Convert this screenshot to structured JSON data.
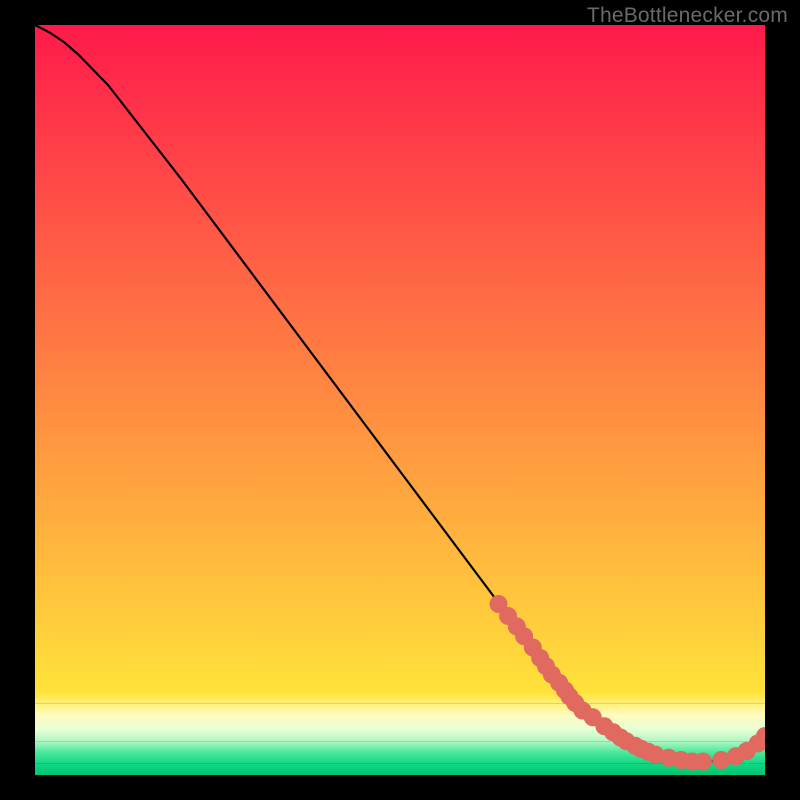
{
  "attribution": "TheBottlenecker.com",
  "chart_data": {
    "type": "line",
    "title": "",
    "xlabel": "",
    "ylabel": "",
    "xlim": [
      0,
      100
    ],
    "ylim": [
      0,
      100
    ],
    "series": [
      {
        "name": "curve",
        "stroke": "#000000",
        "x": [
          0.0,
          2.0,
          4.0,
          6.0,
          8.0,
          10.0,
          12.0,
          14.0,
          16.0,
          18.0,
          20.0,
          25.0,
          30.0,
          35.0,
          40.0,
          45.0,
          50.0,
          55.0,
          60.0,
          65.0,
          68.0,
          71.0,
          74.0,
          76.0,
          78.0,
          80.0,
          82.0,
          84.0,
          86.0,
          88.0,
          90.0,
          92.0,
          94.0,
          96.0,
          97.5,
          99.0,
          100.0
        ],
        "y": [
          100.0,
          99.0,
          97.7,
          96.0,
          94.0,
          92.0,
          89.5,
          87.0,
          84.5,
          82.0,
          79.5,
          73.0,
          66.5,
          60.0,
          53.5,
          47.0,
          40.5,
          34.0,
          27.5,
          21.0,
          17.0,
          13.5,
          10.0,
          8.0,
          6.5,
          5.2,
          4.0,
          3.1,
          2.4,
          2.0,
          1.8,
          1.8,
          2.0,
          2.5,
          3.2,
          4.2,
          5.2
        ]
      }
    ],
    "markers": {
      "name": "dots",
      "color": "#e06a5f",
      "radius_px": 9,
      "x": [
        63.5,
        64.8,
        66.0,
        67.0,
        68.2,
        69.2,
        70.0,
        70.8,
        71.8,
        72.6,
        73.2,
        74.0,
        75.0,
        76.4,
        78.0,
        79.2,
        80.2,
        81.0,
        82.2,
        83.0,
        84.0,
        85.0,
        86.8,
        88.5,
        90.0,
        91.5,
        94.0,
        96.0,
        97.5,
        99.0,
        100.0
      ],
      "y": [
        22.8,
        21.2,
        19.8,
        18.5,
        17.0,
        15.6,
        14.5,
        13.4,
        12.3,
        11.3,
        10.5,
        9.6,
        8.6,
        7.7,
        6.5,
        5.7,
        5.0,
        4.5,
        3.9,
        3.5,
        3.1,
        2.7,
        2.3,
        2.0,
        1.8,
        1.8,
        2.0,
        2.5,
        3.2,
        4.2,
        5.2
      ]
    },
    "gradient_bands": [
      {
        "y0": 100,
        "y1": 11,
        "top": "#ff1a4b",
        "bottom": "#ffe23a"
      },
      {
        "y0": 11,
        "y1": 9.5,
        "top": "#ffe23a",
        "bottom": "#fff07a"
      },
      {
        "y0": 9.5,
        "y1": 8.0,
        "top": "#fff07a",
        "bottom": "#fffbc0"
      },
      {
        "y0": 8.0,
        "y1": 6.0,
        "top": "#fffbc0",
        "bottom": "#e6ffd5"
      },
      {
        "y0": 6.0,
        "y1": 4.5,
        "top": "#e6ffd5",
        "bottom": "#aef7c3"
      },
      {
        "y0": 4.5,
        "y1": 3.0,
        "top": "#aef7c3",
        "bottom": "#49e89b"
      },
      {
        "y0": 3.0,
        "y1": 1.5,
        "top": "#49e89b",
        "bottom": "#11d883"
      },
      {
        "y0": 1.5,
        "y1": 0.0,
        "top": "#11d883",
        "bottom": "#00c570"
      }
    ]
  }
}
